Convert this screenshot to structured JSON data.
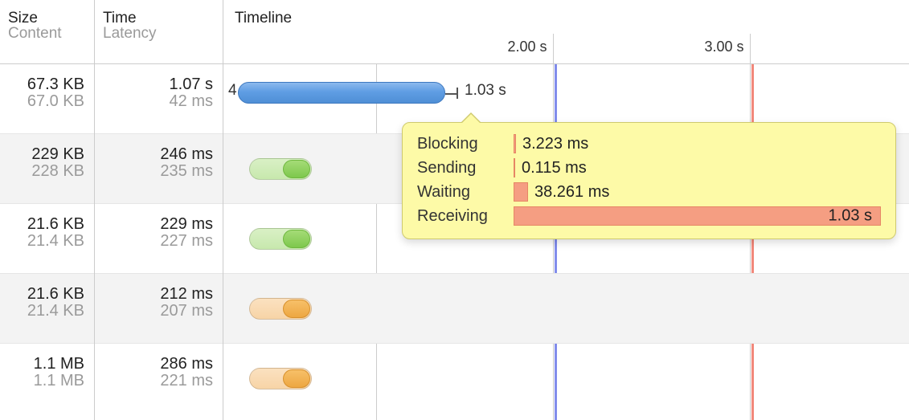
{
  "headers": {
    "size1": "Size",
    "size2": "Content",
    "time1": "Time",
    "time2": "Latency",
    "timeline": "Timeline"
  },
  "ticks": {
    "t1": "2.00 s",
    "t2": "3.00 s"
  },
  "rows": [
    {
      "size": "67.3 KB",
      "content": "67.0 KB",
      "time": "1.07 s",
      "latency": "42 ms"
    },
    {
      "size": "229 KB",
      "content": "228 KB",
      "time": "246 ms",
      "latency": "235 ms"
    },
    {
      "size": "21.6 KB",
      "content": "21.4 KB",
      "time": "229 ms",
      "latency": "227 ms"
    },
    {
      "size": "21.6 KB",
      "content": "21.4 KB",
      "time": "212 ms",
      "latency": "207 ms"
    },
    {
      "size": "1.1 MB",
      "content": "1.1 MB",
      "time": "286 ms",
      "latency": "221 ms"
    }
  ],
  "bar1": {
    "left_label": "4",
    "right_label": "1.03 s"
  },
  "tooltip": {
    "blocking_label": "Blocking",
    "blocking_value": "3.223 ms",
    "sending_label": "Sending",
    "sending_value": "0.115 ms",
    "waiting_label": "Waiting",
    "waiting_value": "38.261 ms",
    "receiving_label": "Receiving",
    "receiving_value": "1.03 s"
  }
}
